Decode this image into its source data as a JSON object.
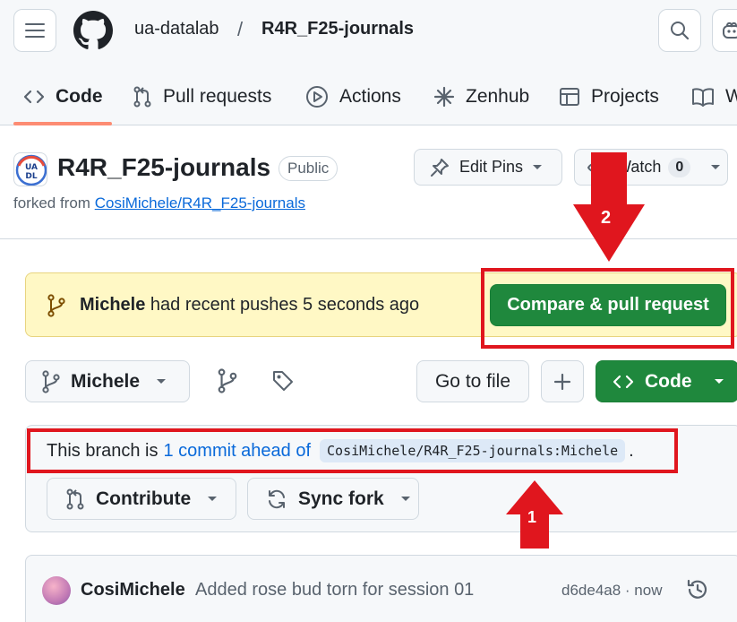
{
  "header": {
    "owner": "ua-datalab",
    "separator": "/",
    "repo": "R4R_F25-journals"
  },
  "tabs": [
    {
      "label": "Code",
      "icon": "code-icon",
      "active": true
    },
    {
      "label": "Pull requests",
      "icon": "pull-request-icon"
    },
    {
      "label": "Actions",
      "icon": "actions-play-icon"
    },
    {
      "label": "Zenhub",
      "icon": "zenhub-icon"
    },
    {
      "label": "Projects",
      "icon": "projects-table-icon"
    },
    {
      "label": "W",
      "icon": "wiki-book-icon"
    }
  ],
  "repo": {
    "title": "R4R_F25-journals",
    "visibility": "Public",
    "forked_prefix": "forked from",
    "forked_link": "CosiMichele/R4R_F25-journals",
    "avatar_text_top": "UA",
    "avatar_text_bottom": "DL"
  },
  "actions": {
    "edit_pins": "Edit Pins",
    "watch": "Watch",
    "watch_count": "0"
  },
  "banner": {
    "user": "Michele",
    "message": " had recent pushes 5 seconds ago",
    "button": "Compare & pull request"
  },
  "toolbar": {
    "branch": "Michele",
    "go_to_file": "Go to file",
    "code_button": "Code"
  },
  "branch_status": {
    "prefix": "This branch is",
    "link": "1 commit ahead of",
    "target": "CosiMichele/R4R_F25-journals:Michele",
    "suffix": ".",
    "contribute": "Contribute",
    "sync_fork": "Sync fork"
  },
  "latest_commit": {
    "author": "CosiMichele",
    "message": "Added rose bud torn for session 01",
    "sha_time": "d6de4a8 · now"
  },
  "annotations": {
    "arrow_1_label": "1",
    "arrow_2_label": "2",
    "color": "#e0161e"
  },
  "colors": {
    "primary_green": "#1f883d",
    "link_blue": "#0969da",
    "banner_yellow": "#fff8c5",
    "tab_underline": "#fd8c73"
  }
}
